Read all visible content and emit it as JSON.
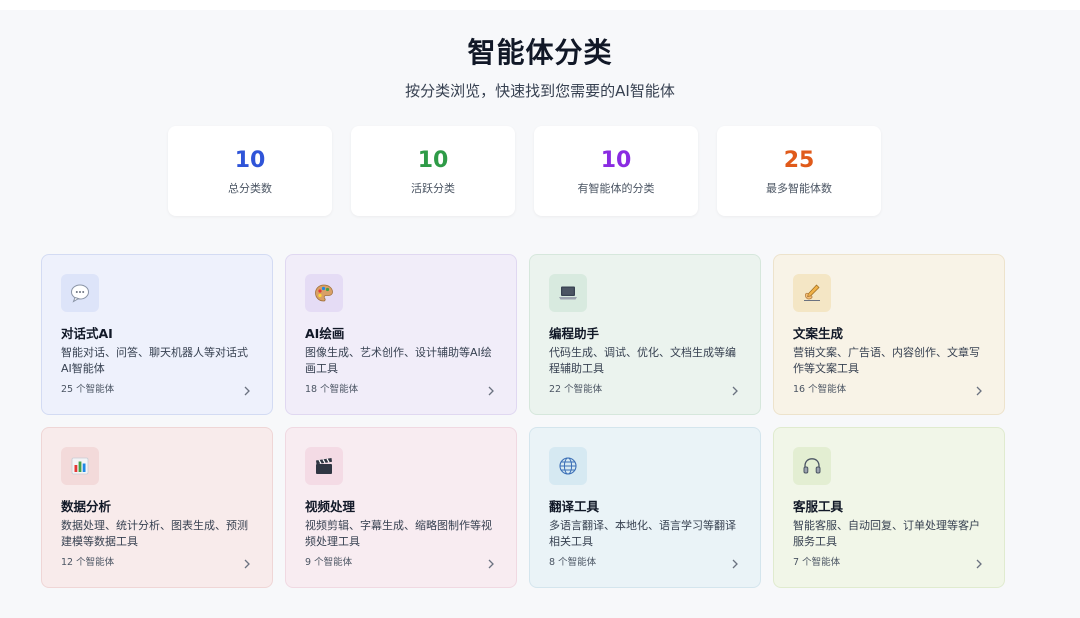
{
  "header": {
    "title": "智能体分类",
    "subtitle": "按分类浏览，快速找到您需要的AI智能体"
  },
  "stats": [
    {
      "value": "10",
      "label": "总分类数",
      "color": "#2f54d8"
    },
    {
      "value": "10",
      "label": "活跃分类",
      "color": "#2e9b47"
    },
    {
      "value": "10",
      "label": "有智能体的分类",
      "color": "#8a2be2"
    },
    {
      "value": "25",
      "label": "最多智能体数",
      "color": "#e05a1a"
    }
  ],
  "categories": [
    {
      "title": "对话式AI",
      "desc": "智能对话、问答、聊天机器人等对话式AI智能体",
      "count": "25 个智能体",
      "icon": "speech-bubble-icon",
      "bg": "#eef1fc",
      "border": "#d3dbf3",
      "icon_bg": "#dde4f9"
    },
    {
      "title": "AI绘画",
      "desc": "图像生成、艺术创作、设计辅助等AI绘画工具",
      "count": "18 个智能体",
      "icon": "palette-icon",
      "bg": "#f1edf9",
      "border": "#e0d8f1",
      "icon_bg": "#e5dcf5"
    },
    {
      "title": "编程助手",
      "desc": "代码生成、调试、优化、文档生成等编程辅助工具",
      "count": "22 个智能体",
      "icon": "laptop-icon",
      "bg": "#ebf3ee",
      "border": "#d6e7dc",
      "icon_bg": "#d8eadf"
    },
    {
      "title": "文案生成",
      "desc": "营销文案、广告语、内容创作、文章写作等文案工具",
      "count": "16 个智能体",
      "icon": "writing-hand-icon",
      "bg": "#f8f3e7",
      "border": "#ede3cc",
      "icon_bg": "#f4e6c5"
    },
    {
      "title": "数据分析",
      "desc": "数据处理、统计分析、图表生成、预测建模等数据工具",
      "count": "12 个智能体",
      "icon": "bar-chart-icon",
      "bg": "#f8ebeb",
      "border": "#efd6d6",
      "icon_bg": "#f3dada"
    },
    {
      "title": "视频处理",
      "desc": "视频剪辑、字幕生成、缩略图制作等视频处理工具",
      "count": "9 个智能体",
      "icon": "clapperboard-icon",
      "bg": "#f8ecf1",
      "border": "#f0d9e2",
      "icon_bg": "#f4dbe5"
    },
    {
      "title": "翻译工具",
      "desc": "多语言翻译、本地化、语言学习等翻译相关工具",
      "count": "8 个智能体",
      "icon": "globe-icon",
      "bg": "#eaf3f7",
      "border": "#d4e5ed",
      "icon_bg": "#d6e9f2"
    },
    {
      "title": "客服工具",
      "desc": "智能客服、自动回复、订单处理等客户服务工具",
      "count": "7 个智能体",
      "icon": "headphones-icon",
      "bg": "#f1f6e8",
      "border": "#e0ebcf",
      "icon_bg": "#e3eed2"
    }
  ]
}
